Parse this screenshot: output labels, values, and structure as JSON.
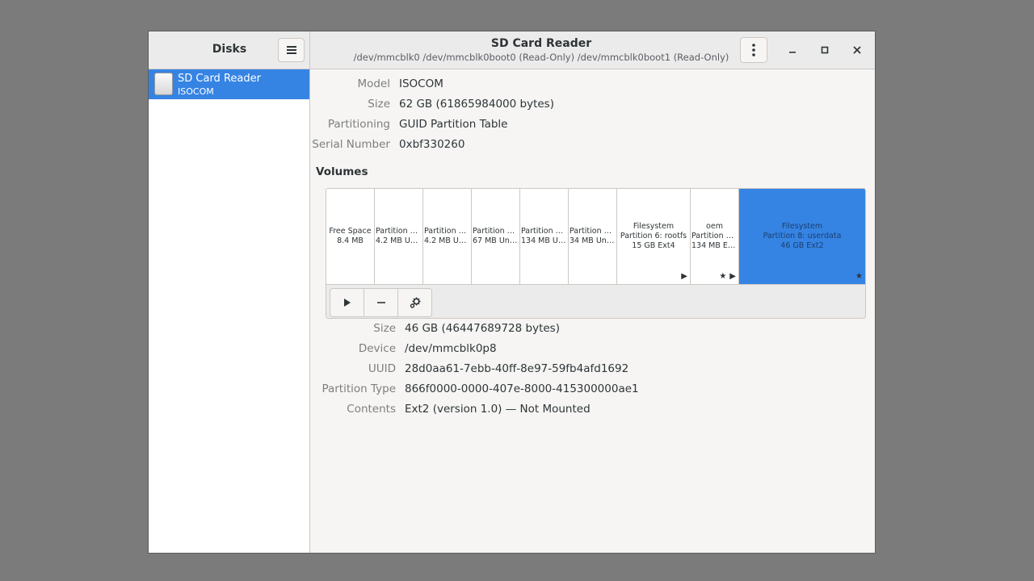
{
  "app": {
    "title": "Disks"
  },
  "window": {
    "title": "SD Card Reader",
    "subtitle": "/dev/mmcblk0 /dev/mmcblk0boot0 (Read-Only) /dev/mmcblk0boot1 (Read-Only)"
  },
  "sidebar": {
    "drives": [
      {
        "name": "SD Card Reader",
        "model": "ISOCOM"
      }
    ]
  },
  "drive_props": {
    "model_label": "Model",
    "model_value": "ISOCOM",
    "size_label": "Size",
    "size_value": "62 GB (61865984000 bytes)",
    "partitioning_label": "Partitioning",
    "partitioning_value": "GUID Partition Table",
    "serial_label": "Serial Number",
    "serial_value": "0xbf330260"
  },
  "volumes": {
    "title": "Volumes",
    "segments": [
      {
        "lines": [
          "Free Space",
          "8.4 MB"
        ]
      },
      {
        "lines": [
          "Partition 1…",
          "4.2 MB Un…"
        ]
      },
      {
        "lines": [
          "Partition 2…",
          "4.2 MB Un…"
        ]
      },
      {
        "lines": [
          "Partition 3…",
          "67 MB Unk…"
        ]
      },
      {
        "lines": [
          "Partition 4…",
          "134 MB Un…"
        ]
      },
      {
        "lines": [
          "Partition 5…",
          "34 MB Unk…"
        ]
      },
      {
        "lines": [
          "Filesystem",
          "Partition 6: rootfs",
          "15 GB Ext4"
        ]
      },
      {
        "lines": [
          "oem",
          "Partition 7…",
          "134 MB Ext2"
        ]
      },
      {
        "lines": [
          "Filesystem",
          "Partition 8: userdata",
          "46 GB Ext2"
        ]
      }
    ]
  },
  "partition_props": {
    "size_label": "Size",
    "size_value": "46 GB (46447689728 bytes)",
    "device_label": "Device",
    "device_value": "/dev/mmcblk0p8",
    "uuid_label": "UUID",
    "uuid_value": "28d0aa61-7ebb-40ff-8e97-59fb4afd1692",
    "type_label": "Partition Type",
    "type_value": "866f0000-0000-407e-8000-415300000ae1",
    "contents_label": "Contents",
    "contents_value": "Ext2 (version 1.0) — Not Mounted"
  },
  "colors": {
    "accent": "#3584e4",
    "desktop": "#7b7b7b"
  },
  "icons": [
    "menu-icon",
    "kebab-menu-icon",
    "minimize-icon",
    "maximize-icon",
    "close-icon",
    "sd-card-icon",
    "play-icon",
    "minus-icon",
    "gears-icon",
    "star-icon"
  ]
}
